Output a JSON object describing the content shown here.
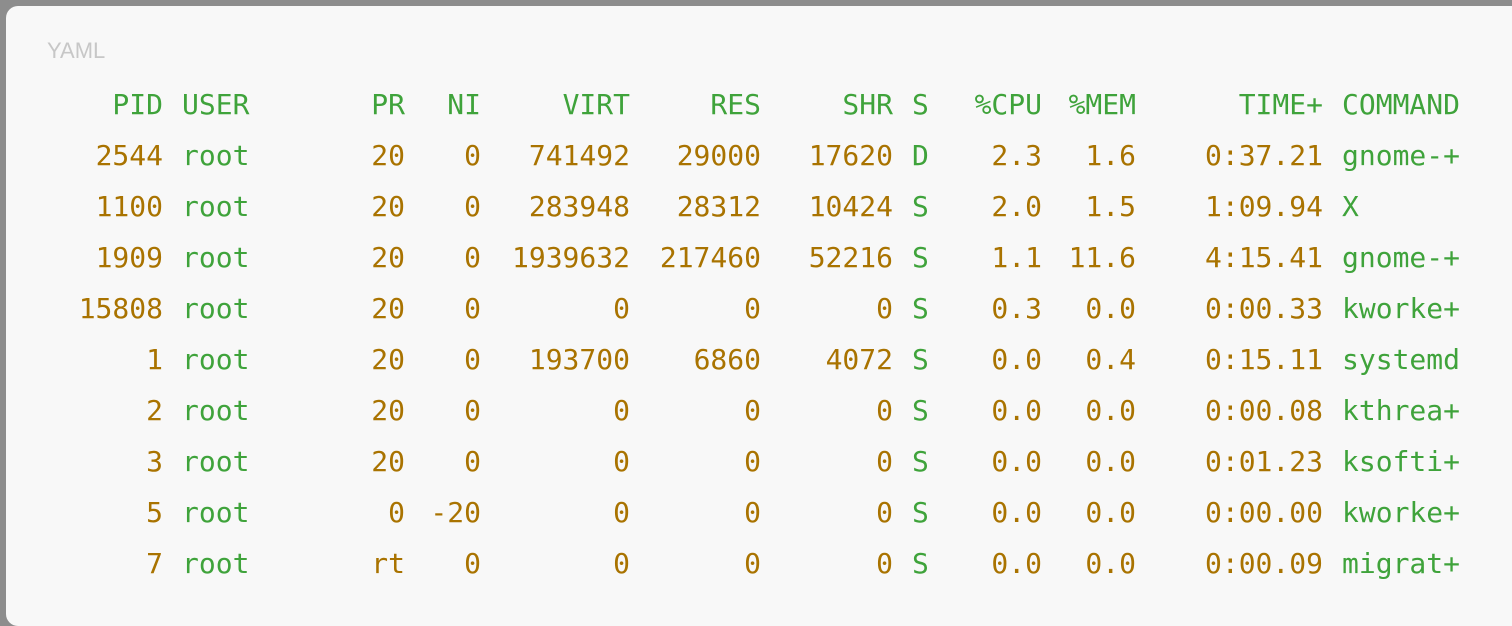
{
  "code_block": {
    "language_label": "YAML"
  },
  "colors": {
    "header": "#3fa33b",
    "number": "#a97300",
    "text": "#3fa33b",
    "card_background": "#f8f8f8",
    "page_background": "#8d8d8d"
  },
  "columns": [
    {
      "key": "pid",
      "label": "PID"
    },
    {
      "key": "user",
      "label": "USER"
    },
    {
      "key": "pr",
      "label": "PR"
    },
    {
      "key": "ni",
      "label": "NI"
    },
    {
      "key": "virt",
      "label": "VIRT"
    },
    {
      "key": "res",
      "label": "RES"
    },
    {
      "key": "shr",
      "label": "SHR"
    },
    {
      "key": "s",
      "label": "S"
    },
    {
      "key": "cpu",
      "label": "%CPU"
    },
    {
      "key": "mem",
      "label": "%MEM"
    },
    {
      "key": "time",
      "label": "TIME+"
    },
    {
      "key": "command",
      "label": "COMMAND"
    }
  ],
  "rows": [
    {
      "pid": "2544",
      "user": "root",
      "pr": "20",
      "ni": "0",
      "virt": "741492",
      "res": "29000",
      "shr": "17620",
      "s": "D",
      "cpu": "2.3",
      "mem": "1.6",
      "time": "0:37.21",
      "command": "gnome-+"
    },
    {
      "pid": "1100",
      "user": "root",
      "pr": "20",
      "ni": "0",
      "virt": "283948",
      "res": "28312",
      "shr": "10424",
      "s": "S",
      "cpu": "2.0",
      "mem": "1.5",
      "time": "1:09.94",
      "command": "X"
    },
    {
      "pid": "1909",
      "user": "root",
      "pr": "20",
      "ni": "0",
      "virt": "1939632",
      "res": "217460",
      "shr": "52216",
      "s": "S",
      "cpu": "1.1",
      "mem": "11.6",
      "time": "4:15.41",
      "command": "gnome-+"
    },
    {
      "pid": "15808",
      "user": "root",
      "pr": "20",
      "ni": "0",
      "virt": "0",
      "res": "0",
      "shr": "0",
      "s": "S",
      "cpu": "0.3",
      "mem": "0.0",
      "time": "0:00.33",
      "command": "kworke+"
    },
    {
      "pid": "1",
      "user": "root",
      "pr": "20",
      "ni": "0",
      "virt": "193700",
      "res": "6860",
      "shr": "4072",
      "s": "S",
      "cpu": "0.0",
      "mem": "0.4",
      "time": "0:15.11",
      "command": "systemd"
    },
    {
      "pid": "2",
      "user": "root",
      "pr": "20",
      "ni": "0",
      "virt": "0",
      "res": "0",
      "shr": "0",
      "s": "S",
      "cpu": "0.0",
      "mem": "0.0",
      "time": "0:00.08",
      "command": "kthrea+"
    },
    {
      "pid": "3",
      "user": "root",
      "pr": "20",
      "ni": "0",
      "virt": "0",
      "res": "0",
      "shr": "0",
      "s": "S",
      "cpu": "0.0",
      "mem": "0.0",
      "time": "0:01.23",
      "command": "ksofti+"
    },
    {
      "pid": "5",
      "user": "root",
      "pr": "0",
      "ni": "-20",
      "virt": "0",
      "res": "0",
      "shr": "0",
      "s": "S",
      "cpu": "0.0",
      "mem": "0.0",
      "time": "0:00.00",
      "command": "kworke+"
    },
    {
      "pid": "7",
      "user": "root",
      "pr": "rt",
      "ni": "0",
      "virt": "0",
      "res": "0",
      "shr": "0",
      "s": "S",
      "cpu": "0.0",
      "mem": "0.0",
      "time": "0:00.09",
      "command": "migrat+"
    }
  ]
}
